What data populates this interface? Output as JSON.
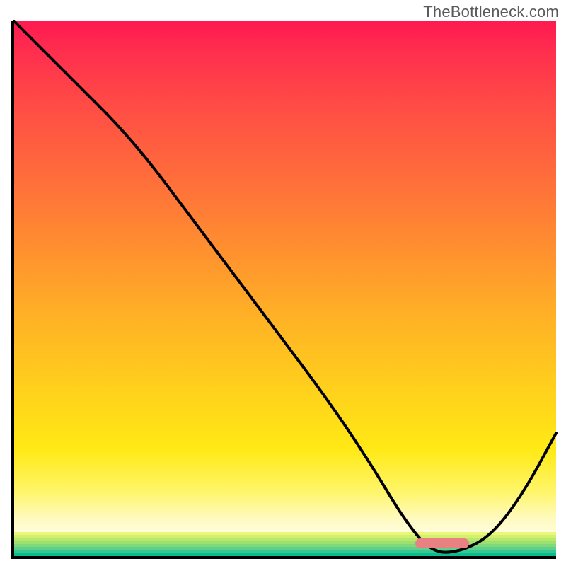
{
  "watermark": "TheBottleneck.com",
  "chart_data": {
    "type": "line",
    "title": "",
    "xlabel": "",
    "ylabel": "",
    "xlim": [
      0,
      100
    ],
    "ylim": [
      0,
      100
    ],
    "grid": false,
    "series": [
      {
        "name": "bottleneck-curve",
        "x": [
          0,
          10,
          22,
          34,
          46,
          58,
          66,
          72,
          77,
          82,
          88,
          94,
          100
        ],
        "y": [
          100,
          90,
          78,
          62,
          46,
          30,
          18,
          8,
          2,
          2,
          5,
          13,
          24
        ]
      }
    ],
    "annotations": [
      {
        "name": "optimal-range-marker",
        "x_start": 74,
        "x_end": 84,
        "y": 1.5
      }
    ],
    "gradient_stops": [
      {
        "pct": 0,
        "color": "#ff1950"
      },
      {
        "pct": 50,
        "color": "#ff9a2c"
      },
      {
        "pct": 80,
        "color": "#ffe915"
      },
      {
        "pct": 100,
        "color": "#fffef6"
      }
    ],
    "bottom_bands": [
      "#e9f77a",
      "#d2f06e",
      "#b7e86c",
      "#9de072",
      "#80d87c",
      "#5fd087",
      "#37c793",
      "#08bd8e"
    ]
  }
}
